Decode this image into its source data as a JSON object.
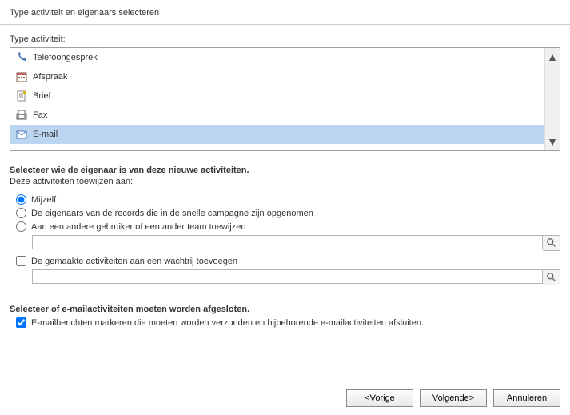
{
  "title": "Type activiteit en eigenaars selecteren",
  "list_label": "Type activiteit:",
  "activities": [
    {
      "name": "Telefoongesprek",
      "icon": "phone-icon",
      "selected": false
    },
    {
      "name": "Afspraak",
      "icon": "calendar-icon",
      "selected": false
    },
    {
      "name": "Brief",
      "icon": "letter-icon",
      "selected": false
    },
    {
      "name": "Fax",
      "icon": "fax-icon",
      "selected": false
    },
    {
      "name": "E-mail",
      "icon": "mail-icon",
      "selected": true
    }
  ],
  "owner": {
    "heading": "Selecteer wie de eigenaar is van deze nieuwe activiteiten.",
    "assign_label": "Deze activiteiten toewijzen aan:",
    "options": {
      "myself": "Mijzelf",
      "record_owners": "De eigenaars van de records die in de snelle campagne zijn opgenomen",
      "other_user": "Aan een andere gebruiker of een ander team toewijzen"
    },
    "selected": "myself",
    "other_user_value": "",
    "queue_checkbox": "De gemaakte activiteiten aan een wachtrij toevoegen",
    "queue_checked": false,
    "queue_value": ""
  },
  "email_close": {
    "heading": "Selecteer of e-mailactiviteiten moeten worden afgesloten.",
    "checkbox": "E-mailberichten markeren die moeten worden verzonden en bijbehorende e-mailactiviteiten afsluiten.",
    "checked": true
  },
  "buttons": {
    "back": "<Vorige",
    "next": "Volgende>",
    "cancel": "Annuleren"
  }
}
